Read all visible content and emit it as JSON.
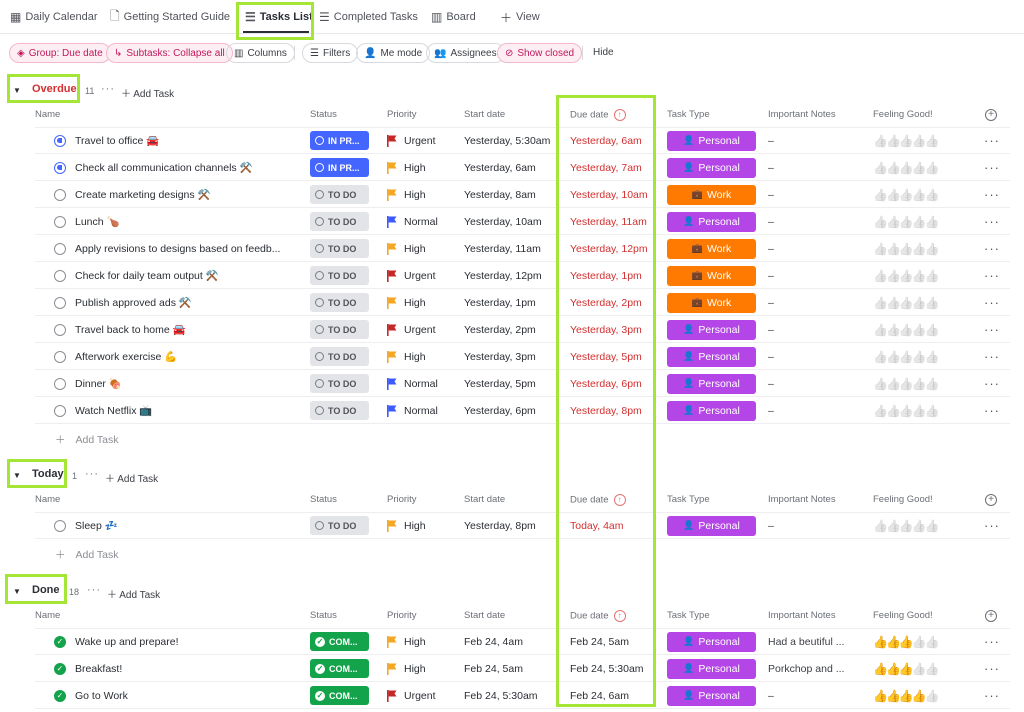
{
  "tabs": [
    {
      "label": "Daily Calendar",
      "icon": "calendar-icon"
    },
    {
      "label": "Getting Started Guide",
      "icon": "doc-icon"
    },
    {
      "label": "Tasks List",
      "icon": "list-icon",
      "active": true
    },
    {
      "label": "Completed Tasks",
      "icon": "list-icon"
    },
    {
      "label": "Board",
      "icon": "board-icon"
    },
    {
      "label": "View",
      "icon": "plus-icon"
    }
  ],
  "toolbar": {
    "group": "Group: Due date",
    "subtasks": "Subtasks: Collapse all",
    "columns": "Columns",
    "filters": "Filters",
    "me_mode": "Me mode",
    "assignees": "Assignees",
    "show_closed": "Show closed",
    "hide": "Hide"
  },
  "columns": {
    "name": "Name",
    "status": "Status",
    "priority": "Priority",
    "start": "Start date",
    "due": "Due date",
    "type": "Task Type",
    "notes": "Important Notes",
    "feeling": "Feeling Good!"
  },
  "add_task": "Add Task",
  "groups": [
    {
      "label": "Overdue",
      "count": "11",
      "color": "#d32f2f",
      "rows": [
        {
          "name": "Travel to office 🚘",
          "state": "prog",
          "status": "IN PR...",
          "priority": "Urgent",
          "start": "Yesterday, 5:30am",
          "due": "Yesterday, 6am",
          "type": "Personal",
          "notes": "–",
          "feeling": 0
        },
        {
          "name": "Check all communication channels ⚒️",
          "state": "prog",
          "status": "IN PR...",
          "priority": "High",
          "start": "Yesterday, 6am",
          "due": "Yesterday, 7am",
          "type": "Personal",
          "notes": "–",
          "feeling": 0
        },
        {
          "name": "Create marketing designs ⚒️",
          "state": "todo",
          "status": "TO DO",
          "priority": "High",
          "start": "Yesterday, 8am",
          "due": "Yesterday, 10am",
          "type": "Work",
          "notes": "–",
          "feeling": 0
        },
        {
          "name": "Lunch 🍗",
          "state": "todo",
          "status": "TO DO",
          "priority": "Normal",
          "start": "Yesterday, 10am",
          "due": "Yesterday, 11am",
          "type": "Personal",
          "notes": "–",
          "feeling": 0
        },
        {
          "name": "Apply revisions to designs based on feedb...",
          "state": "todo",
          "status": "TO DO",
          "priority": "High",
          "start": "Yesterday, 11am",
          "due": "Yesterday, 12pm",
          "type": "Work",
          "notes": "–",
          "feeling": 0
        },
        {
          "name": "Check for daily team output ⚒️",
          "state": "todo",
          "status": "TO DO",
          "priority": "Urgent",
          "start": "Yesterday, 12pm",
          "due": "Yesterday, 1pm",
          "type": "Work",
          "notes": "–",
          "feeling": 0
        },
        {
          "name": "Publish approved ads ⚒️",
          "state": "todo",
          "status": "TO DO",
          "priority": "High",
          "start": "Yesterday, 1pm",
          "due": "Yesterday, 2pm",
          "type": "Work",
          "notes": "–",
          "feeling": 0
        },
        {
          "name": "Travel back to home 🚘",
          "state": "todo",
          "status": "TO DO",
          "priority": "Urgent",
          "start": "Yesterday, 2pm",
          "due": "Yesterday, 3pm",
          "type": "Personal",
          "notes": "–",
          "feeling": 0
        },
        {
          "name": "Afterwork exercise 💪",
          "state": "todo",
          "status": "TO DO",
          "priority": "High",
          "start": "Yesterday, 3pm",
          "due": "Yesterday, 5pm",
          "type": "Personal",
          "notes": "–",
          "feeling": 0
        },
        {
          "name": "Dinner 🍖",
          "state": "todo",
          "status": "TO DO",
          "priority": "Normal",
          "start": "Yesterday, 5pm",
          "due": "Yesterday, 6pm",
          "type": "Personal",
          "notes": "–",
          "feeling": 0
        },
        {
          "name": "Watch Netflix 📺",
          "state": "todo",
          "status": "TO DO",
          "priority": "Normal",
          "start": "Yesterday, 6pm",
          "due": "Yesterday, 8pm",
          "type": "Personal",
          "notes": "–",
          "feeling": 0
        }
      ]
    },
    {
      "label": "Today",
      "count": "1",
      "color": "#2a2e34",
      "rows": [
        {
          "name": "Sleep 💤",
          "state": "todo",
          "status": "TO DO",
          "priority": "High",
          "start": "Yesterday, 8pm",
          "due": "Today, 4am",
          "type": "Personal",
          "notes": "–",
          "feeling": 0
        }
      ]
    },
    {
      "label": "Done",
      "count": "18",
      "color": "#2a2e34",
      "rows": [
        {
          "name": "Wake up and prepare!",
          "state": "done",
          "status": "COM...",
          "priority": "High",
          "start": "Feb 24, 4am",
          "due": "Feb 24, 5am",
          "type": "Personal",
          "notes": "Had a beutiful ...",
          "feeling": 3
        },
        {
          "name": "Breakfast!",
          "state": "done",
          "status": "COM...",
          "priority": "High",
          "start": "Feb 24, 5am",
          "due": "Feb 24, 5:30am",
          "type": "Personal",
          "notes": "Porkchop and ...",
          "feeling": 3
        },
        {
          "name": "Go to Work",
          "state": "done",
          "status": "COM...",
          "priority": "Urgent",
          "start": "Feb 24, 5:30am",
          "due": "Feb 24, 6am",
          "type": "Personal",
          "notes": "–",
          "feeling": 4
        }
      ]
    }
  ],
  "colors": {
    "urgent": "#c62828",
    "high": "#f5a623",
    "normal": "#3d5afe",
    "personal": "#b445e6",
    "work": "#ff7a00",
    "highlight": "#a3e635"
  }
}
